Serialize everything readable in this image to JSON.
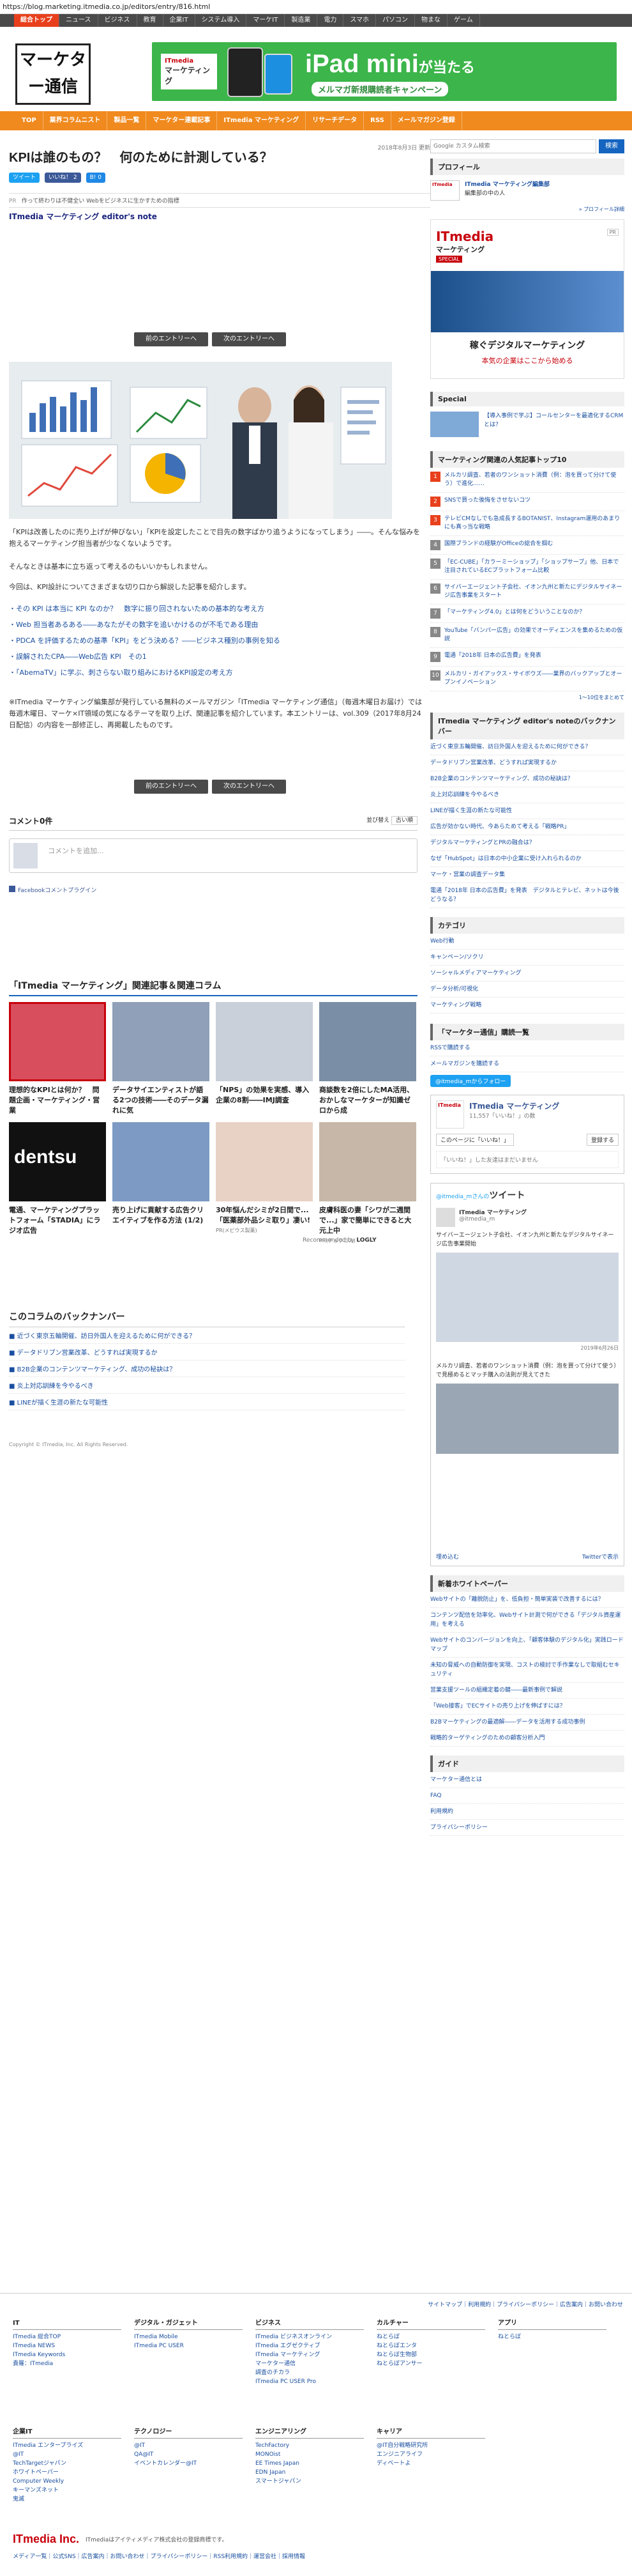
{
  "url": "https://blog.marketing.itmedia.co.jp/editors/entry/816.html",
  "gnav": [
    "総合トップ",
    "ニュース",
    "ビジネス",
    "教育",
    "企業IT",
    "システム導入",
    "マーケIT",
    "製造業",
    "電力",
    "スマホ",
    "パソコン",
    "物まな",
    "ゲーム"
  ],
  "logo": {
    "text": "マーケター通信",
    "alt": "マーケター通信"
  },
  "banner": {
    "brand_top": "ITmedia",
    "brand_name": "マーケティング",
    "headline_pre": "iPad mini",
    "headline_post": "が当たる",
    "sub": "メルマガ新規購読者キャンペーン"
  },
  "onav": [
    "TOP",
    "業界コラムニスト",
    "製品一覧",
    "マーケター連載記事",
    "ITmedia マーケティング",
    "リサーチデータ",
    "RSS",
    "メールマガジン登録"
  ],
  "article": {
    "date": "2018年8月3日 更新",
    "title": "KPIは誰のもの？　何のために計測している？",
    "tweet": "ツイート",
    "like": "いいね！ 2",
    "hatena": "B! 0",
    "pr_label": "PR",
    "pr_text": "作って終わりは不健全い Webをビジネスに生かすための指標",
    "series": "ITmedia マーケティング editor's note",
    "prev": "前のエントリーへ",
    "next": "次のエントリーへ",
    "p1": "「KPIは改善したのに売り上げが伸びない」「KPIを設定したことで目先の数字ばかり追うようになってしまう」――。そんな悩みを抱えるマーケティング担当者が少なくないようです。",
    "p2": "そんなときは基本に立ち返って考えるのもいいかもしれません。",
    "p3": "今回は、KPI設計についてさまざまな切り口から解説した記事を紹介します。",
    "bullets": [
      "その KPI は本当に KPI なのか？　数字に振り回されないための基本的な考え方",
      "Web 担当者あるある――あなたがその数字を追いかけるのが不毛である理由",
      "PDCA を評価するための基準「KPI」をどう決める？――ビジネス種別の事例を知る",
      "誤解されたCPA――Web広告 KPI　その1",
      "「AbemaTV」に学ぶ、刺さらない取り組みにおけるKPI設定の考え方"
    ],
    "p4": "※ITmedia マーケティング編集部が発行している無料のメールマガジン「ITmedia マーケティング通信」（毎週木曜日お届け）では毎週木曜日、マーケ×IT領域の気になるテーマを取り上げ、関連記事を紹介しています。本エントリーは、vol.309（2017年8月24日配信）の内容を一部修正し、再掲載したものです。"
  },
  "comments": {
    "title": "コメント0件",
    "sort_label": "並び替え",
    "sort_value": "古い順",
    "placeholder": "コメントを追加...",
    "plugin": "Facebookコメントプラグイン"
  },
  "related": {
    "title": "「ITmedia マーケティング」関連記事＆関連コラム",
    "cards": [
      {
        "title": "理想的なKPIとは何か？　問題企画・マーケティング・営業",
        "meta": ""
      },
      {
        "title": "データサイエンティストが語る2つの技術――そのデータ漏れに気",
        "meta": ""
      },
      {
        "title": "「NPS」の効果を実感、導入企業の8割――IMJ調査",
        "meta": ""
      },
      {
        "title": "商談数を2倍にしたMA活用、おかしなマーケターが知識ゼロから成",
        "meta": ""
      },
      {
        "title": "電通、マーケティングプラットフォーム「STADIA」にラジオ広告",
        "meta": ""
      },
      {
        "title": "売り上げに貢献する広告クリエイティブを作る方法 (1/2)",
        "meta": ""
      },
      {
        "title": "30年悩んだシミが2日間で...「医薬部外品シミ取り」凄い!",
        "meta": "PR(メビウス製薬)"
      },
      {
        "title": "皮膚科医の妻「シワが二週間で...」家で簡単にできると大元上中",
        "meta": "PR(チュラコス)"
      }
    ],
    "recommended": "Recommended by",
    "logly": "LOGLY"
  },
  "backnumber": {
    "title": "このコラムのバックナンバー",
    "items": [
      "近づく東京五輪開催、訪日外国人を迎えるために何ができる？",
      "データドリブン営業改革、どうすれば実現するか",
      "B2B企業のコンテンツマーケティング、成功の秘訣は？",
      "炎上対応訓練を今やるべき",
      "LINEが描く生涯の新たな可能性"
    ]
  },
  "copyright": "Copyright © ITmedia, Inc. All Rights Reserved.",
  "sidebar": {
    "search_placeholder": "Google カスタム検索",
    "search_btn": "検索",
    "profile_title": "プロフィール",
    "profile_name": "ITmedia マーケティング編集部",
    "profile_role": "編集部の中の人",
    "profile_more": "» プロフィール詳細",
    "ad_brand": "ITmedia",
    "ad_brand2": "マーケティング",
    "ad_special": "SPECIAL",
    "ad_copy1": "稼ぐデジタルマーケティング",
    "ad_copy2": "本気の企業はここから始める",
    "ad_pr": "PR",
    "special_title": "Special",
    "special_text": "【導入事例で学ぶ】コールセンターを最適化するCRMとは？",
    "rank_title": "マーケティング関連の人気記事トップ10",
    "ranks": [
      "メルカリ調査、若者のワンショット消費（例：泡を買って分けて使う）で進化……",
      "SNSで買った後悔をさせないコツ",
      "テレビCMなしでも急成長するBOTANIST、Instagram運用のあまりにも真っ当な戦略",
      "国際ブランドの経験がOfficeの総合を掴む",
      "「EC-CUBE」「カラーミーショップ」「ショップサーブ」他、日本で注目されているECプラットフォーム比較",
      "サイバーエージェント子会社、イオン九州と新たにデジタルサイネージ広告事業をスタート",
      "「マーケティング4.0」とは何をどういうことなのか？",
      "YouTube「バンパー広告」の効果でオーディエンスを集めるための仮説",
      "電通「2018年 日本の広告費」を発表",
      "メルカリ・ガイアックス・サイボウズ――業界のバックアップとオープンイノベーション"
    ],
    "rank_more": "1〜10位をまとめて",
    "editors_title": "ITmedia マーケティング editor's noteのバックナンバー",
    "editors": [
      "近づく東京五輪開催、訪日外国人を迎えるために何ができる？",
      "データドリブン営業改革、どうすれば実現するか",
      "B2B企業のコンテンツマーケティング、成功の秘訣は？",
      "炎上対応訓練を今やるべき",
      "LINEが描く生涯の新たな可能性",
      "広告が効かない時代、今あらためて考える「戦略PR」",
      "デジタルマーケティングとPRの融合は？",
      "なぜ「HubSpot」は日本の中小企業に受け入れられるのか",
      "マーケ・営業の調査データ集",
      "電通「2018年 日本の広告費」を発表　デジタルとテレビ、ネットは今後どうなる？"
    ],
    "category_title": "カテゴリ",
    "categories": [
      "Web行動",
      "キャンペーン/ソクリ",
      "ソーシャルメディアマーケティング",
      "データ分析/可視化",
      "マーケティング戦略"
    ],
    "subscribe_title": "「マーケター通信」購読一覧",
    "subscribe": [
      "RSSで購読する",
      "メールマガジンを購読する"
    ],
    "follow_btn": "@itmedia_mからフォロー",
    "fb_page_name": "ITmedia マーケティング",
    "fb_likes": "11,557「いいね！」の数",
    "fb_like_btn": "このページに「いいね！」",
    "fb_share": "登録する",
    "fb_empty": "「いいね！」した友達はまだいません",
    "tweet_title": "ツイート",
    "tweet_handle": "@itmedia_mさんの",
    "tweet_user": "ITmedia マーケティング",
    "tweet_at": "@itmedia_m",
    "tweet_text1": "サイバーエージェント子会社、イオン九州と新たなデジタルサイネージ広告事業開始",
    "tweet_date": "2019年6月26日",
    "tweet_text2": "メルカリ調査、若者のワンショット消費（例：泡を買って分けて使う）で見極めるとマッチ購入の法則が見えてきた",
    "tweet_embed": "埋め込む",
    "tweet_view": "Twitterで表示",
    "whitepaper_title": "新着ホワイトペーパー",
    "whitepapers": [
      "Webサイトの「離脱防止」を、低負担・簡単実装で改善するには？",
      "コンテンツ配信を効率化、Webサイト計測で何ができる「デジタル資産運用」を考える",
      "Webサイトのコンバージョンを向上、「顧客体験のデジタル化」実践ロードマップ",
      "未知の脅威への自動防御を実現、コストの検討で手作業なしで取組むセキュリティ",
      "営業支援ツールの組織定着の鍵――最新事例で解説",
      "「Web接客」でECサイトの売り上げを伸ばすには？",
      "B2Bマーケティングの最適解――データを活用する成功事例",
      "戦略的ターゲティングのための顧客分析入門"
    ],
    "guide_title": "ガイド",
    "guides": [
      "マーケター通信とは",
      "FAQ",
      "利用規約",
      "プライバシーポリシー"
    ]
  },
  "footer": {
    "links": "サイトマップ｜利用規約｜プライバシーポリシー｜広告案内｜お問い合わせ",
    "cols": [
      {
        "head": "IT",
        "items": [
          "ITmedia 総合TOP",
          "ITmedia NEWS",
          "ITmedia Keywords",
          "貴羅：ITmedia"
        ]
      },
      {
        "head": "デジタル・ガジェット",
        "items": [
          "ITmedia Mobile",
          "ITmedia PC USER"
        ]
      },
      {
        "head": "ビジネス",
        "items": [
          "ITmedia ビジネスオンライン",
          "ITmedia エグゼクティブ",
          "ITmedia マーケティング",
          "マーケター通信",
          "調査のチカラ",
          "ITmedia PC USER Pro"
        ]
      },
      {
        "head": "カルチャー",
        "items": [
          "ねとらぼ",
          "ねとらぼエンタ",
          "ねとらぼ生物部",
          "ねとらぼアンサー"
        ]
      },
      {
        "head": "アプリ",
        "items": [
          "ねとらぼ"
        ]
      },
      {
        "head": "企業IT",
        "items": [
          "ITmedia エンタープライズ",
          "@IT",
          "TechTargetジャパン",
          "ホワイトペーパー",
          "Computer Weekly",
          "キーマンズネット",
          "鬼滅"
        ]
      },
      {
        "head": "テクノロジー",
        "items": [
          "@IT",
          "QA@IT",
          "イベントカレンダー@IT"
        ]
      },
      {
        "head": "エンジニアリング",
        "items": [
          "TechFactory",
          "MONOist",
          "EE Times Japan",
          "EDN Japan",
          "スマートジャパン"
        ]
      },
      {
        "head": "キャリア",
        "items": [
          "@IT自分戦略研究所",
          "エンジニアライフ",
          "ディベートよ"
        ]
      }
    ],
    "corp": "ITmedia Inc.",
    "corp_text": "ITmediaはアイティメディア株式会社の登録商標です。",
    "corp_links": "メディア一覧｜公式SNS｜広告案内｜お問い合わせ｜プライバシーポリシー｜RSS利用規約｜運営会社｜採用情報"
  }
}
